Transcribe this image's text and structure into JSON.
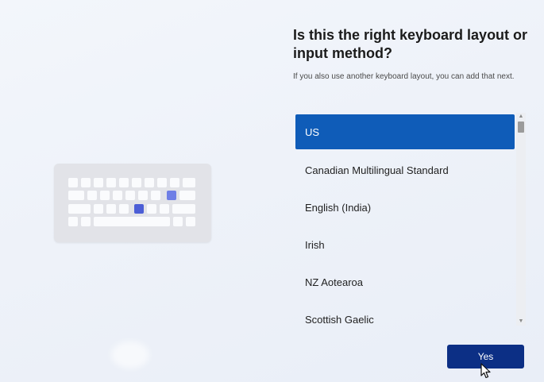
{
  "page": {
    "title": "Is this the right keyboard layout or input method?",
    "subtitle": "If you also use another keyboard layout, you can add that next."
  },
  "illustration": {
    "icon": "keyboard-icon",
    "key_color": "#fafbfd",
    "body_color": "#e2e3e8",
    "accent_colors": [
      "#6f7fe6",
      "#4c5ed6"
    ]
  },
  "layouts": {
    "selected_index": 0,
    "items": [
      {
        "label": "US"
      },
      {
        "label": "Canadian Multilingual Standard"
      },
      {
        "label": "English (India)"
      },
      {
        "label": "Irish"
      },
      {
        "label": "NZ Aotearoa"
      },
      {
        "label": "Scottish Gaelic"
      }
    ]
  },
  "scrollbar": {
    "up_icon": "chevron-up-icon",
    "down_icon": "chevron-down-icon",
    "position_fraction": 0.0
  },
  "actions": {
    "yes_label": "Yes"
  },
  "colors": {
    "selected_item": "#0f5cb8",
    "primary_button": "#0c2f85"
  }
}
